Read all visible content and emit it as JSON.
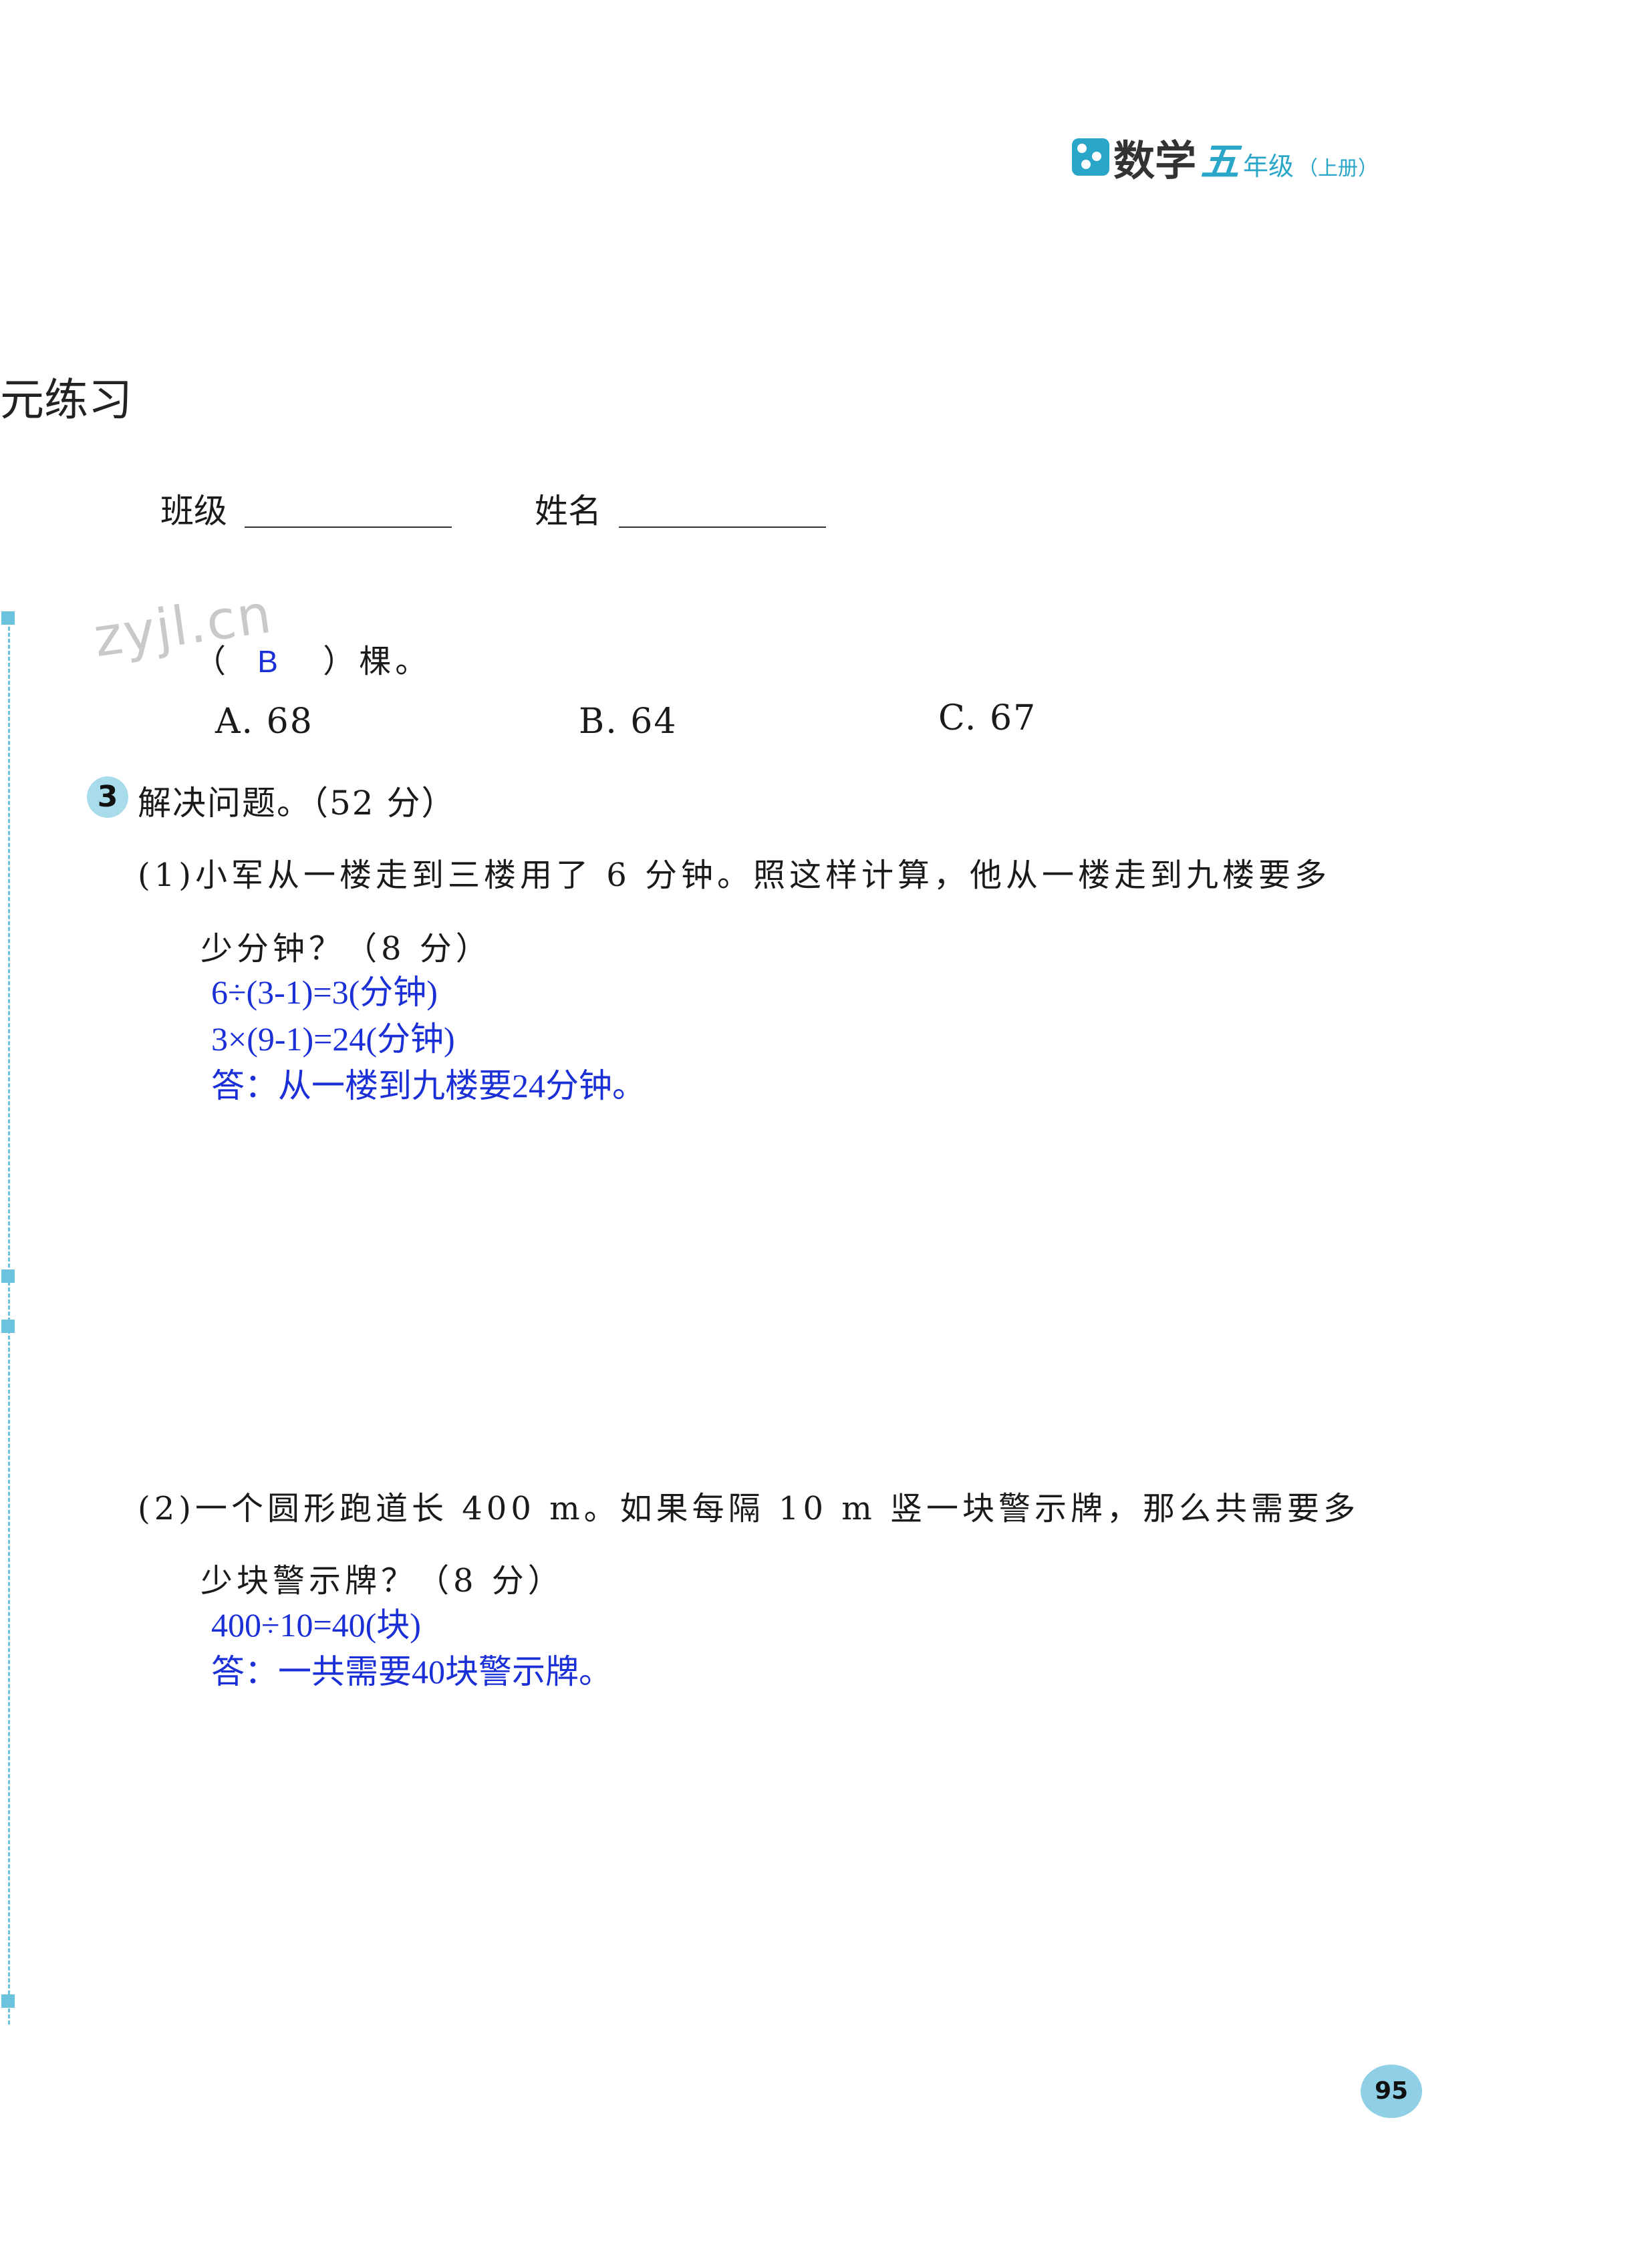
{
  "header": {
    "subject": "数学",
    "grade": "五",
    "grade_word": "年级",
    "volume": "（上册）"
  },
  "unit_title": "元练习",
  "form": {
    "class_label": "班级",
    "name_label": "姓名"
  },
  "watermark": "zyjl.cn",
  "question_tail": {
    "open_paren": "（",
    "answer": "B",
    "close_text": "）棵。"
  },
  "choices": {
    "a": "A. 68",
    "b": "B. 64",
    "c": "C. 67"
  },
  "section3": {
    "number": "3",
    "title": "解决问题。（52 分）"
  },
  "problem1": {
    "line1": "(1)小军从一楼走到三楼用了 6 分钟。照这样计算，他从一楼走到九楼要多",
    "line2": "少分钟？（8 分）",
    "answers": [
      "6÷(3-1)=3(分钟)",
      "3×(9-1)=24(分钟)",
      "答：从一楼到九楼要24分钟。"
    ]
  },
  "problem2": {
    "line1": "(2)一个圆形跑道长 400 m。如果每隔 10 m 竖一块警示牌，那么共需要多",
    "line2": "少块警示牌？（8 分）",
    "answers": [
      "400÷10=40(块)",
      "答：一共需要40块警示牌。"
    ]
  },
  "page_number": "95"
}
